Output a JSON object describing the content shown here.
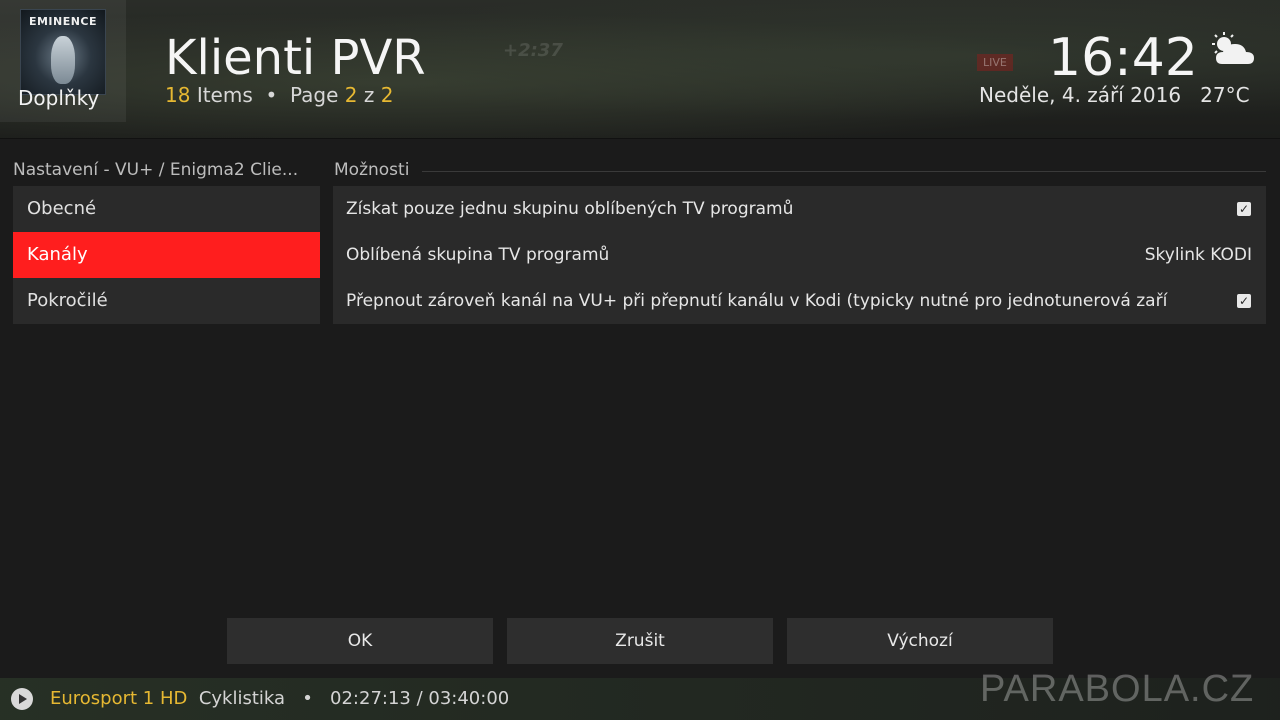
{
  "header": {
    "addon_label": "Doplňky",
    "thumbnail_logo": "EMINENCE",
    "title": "Klienti PVR",
    "items_count": "18",
    "items_label": "Items",
    "separator": "•",
    "page_label": "Page",
    "page_current": "2",
    "page_of": "z",
    "page_total": "2",
    "time": "16:42",
    "date": "Neděle, 4. září 2016",
    "temperature": "27°C",
    "weather_icon": "partly-cloudy-icon",
    "background_overlay_text": "+2:37",
    "background_live_badge": "LIVE"
  },
  "settings": {
    "section_title": "Nastavení - VU+ / Enigma2 Clie...",
    "categories": [
      {
        "label": "Obecné",
        "active": false
      },
      {
        "label": "Kanály",
        "active": true
      },
      {
        "label": "Pokročilé",
        "active": false
      }
    ],
    "options_title": "Možnosti",
    "options": [
      {
        "label": "Získat pouze jednu skupinu oblíbených TV programů",
        "type": "checkbox",
        "checked": true
      },
      {
        "label": "Oblíbená skupina TV programů",
        "type": "value",
        "value": "Skylink KODI"
      },
      {
        "label": "Přepnout zároveň kanál na VU+ při přepnutí kanálu v Kodi (typicky nutné pro jednotunerová zaří",
        "type": "checkbox",
        "checked": true
      }
    ]
  },
  "buttons": {
    "ok": "OK",
    "cancel": "Zrušit",
    "defaults": "Výchozí"
  },
  "footer": {
    "channel": "Eurosport 1 HD",
    "program": "Cyklistika",
    "separator": "•",
    "time": "02:27:13 / 03:40:00",
    "watermark": "PARABOLA.CZ"
  },
  "colors": {
    "accent": "#ff1e1e",
    "highlight_text": "#e6b832"
  }
}
